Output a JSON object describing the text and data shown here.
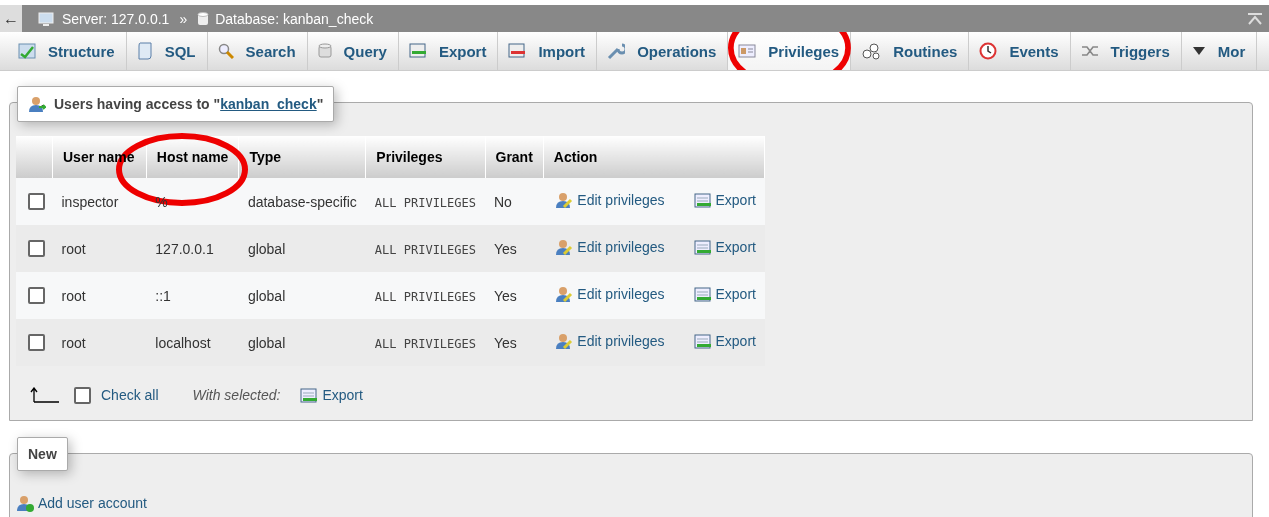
{
  "breadcrumb": {
    "back": "←",
    "server": "Server: 127.0.0.1",
    "separator": "»",
    "database": "Database: kanban_check"
  },
  "tabs": [
    {
      "label": "Structure",
      "selected": false,
      "circled": false
    },
    {
      "label": "SQL",
      "selected": false,
      "circled": false
    },
    {
      "label": "Search",
      "selected": false,
      "circled": false
    },
    {
      "label": "Query",
      "selected": false,
      "circled": false
    },
    {
      "label": "Export",
      "selected": false,
      "circled": false
    },
    {
      "label": "Import",
      "selected": false,
      "circled": false
    },
    {
      "label": "Operations",
      "selected": false,
      "circled": false
    },
    {
      "label": "Privileges",
      "selected": true,
      "circled": true
    },
    {
      "label": "Routines",
      "selected": false,
      "circled": false
    },
    {
      "label": "Events",
      "selected": false,
      "circled": false
    },
    {
      "label": "Triggers",
      "selected": false,
      "circled": false
    },
    {
      "label": "Mor",
      "selected": false,
      "circled": false
    }
  ],
  "access_panel": {
    "legend_prefix": "Users having access to \"",
    "legend_link": "kanban_check",
    "legend_suffix": "\"",
    "columns": [
      {
        "label": "User name",
        "circled": false
      },
      {
        "label": "Host name",
        "circled": true
      },
      {
        "label": "Type",
        "circled": false
      },
      {
        "label": "Privileges",
        "circled": false
      },
      {
        "label": "Grant",
        "circled": false
      },
      {
        "label": "Action",
        "circled": false
      }
    ],
    "rows": [
      {
        "checked": false,
        "user": "inspector",
        "host": "%",
        "type": "database-specific",
        "privileges": "ALL PRIVILEGES",
        "grant": "No",
        "edit": "Edit privileges",
        "export": "Export"
      },
      {
        "checked": false,
        "user": "root",
        "host": "127.0.0.1",
        "type": "global",
        "privileges": "ALL PRIVILEGES",
        "grant": "Yes",
        "edit": "Edit privileges",
        "export": "Export"
      },
      {
        "checked": false,
        "user": "root",
        "host": "::1",
        "type": "global",
        "privileges": "ALL PRIVILEGES",
        "grant": "Yes",
        "edit": "Edit privileges",
        "export": "Export"
      },
      {
        "checked": false,
        "user": "root",
        "host": "localhost",
        "type": "global",
        "privileges": "ALL PRIVILEGES",
        "grant": "Yes",
        "edit": "Edit privileges",
        "export": "Export"
      }
    ],
    "footer": {
      "check_all": "Check all",
      "checked": false,
      "with_selected": "With selected:",
      "export": "Export"
    }
  },
  "new_panel": {
    "legend": "New",
    "link": "Add user account"
  }
}
